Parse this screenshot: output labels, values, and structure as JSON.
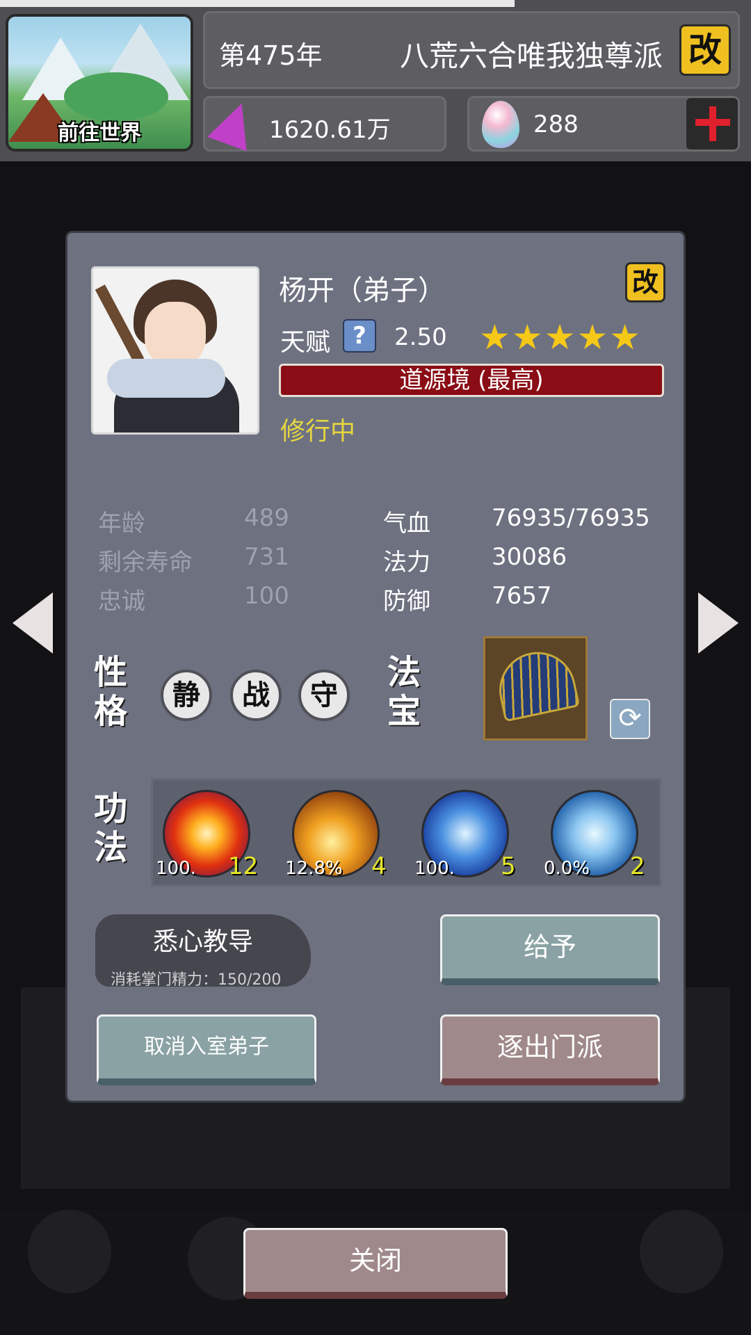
{
  "header": {
    "world_button": "前往世界",
    "year": "第475年",
    "sect_name": "八荒六合唯我独尊派",
    "rename_icon": "改",
    "spirit_stones": "1620.61万",
    "eggs": "288"
  },
  "disciple": {
    "name": "杨开（弟子）",
    "rename_icon": "改",
    "talent_label": "天赋",
    "talent_help": "?",
    "talent_value": "2.50",
    "stars": "★★★★★",
    "star_rating": 5,
    "realm": "道源境 (最高)",
    "status": "修行中"
  },
  "stats_left": [
    {
      "label": "年龄",
      "value": "489"
    },
    {
      "label": "剩余寿命",
      "value": "731"
    },
    {
      "label": "忠诚",
      "value": "100"
    }
  ],
  "stats_right": [
    {
      "label": "气血",
      "value": "76935/76935"
    },
    {
      "label": "法力",
      "value": "30086"
    },
    {
      "label": "防御",
      "value": "7657"
    }
  ],
  "personality": {
    "label_line1": "性",
    "label_line2": "格",
    "traits": [
      "静",
      "战",
      "守"
    ]
  },
  "treasure": {
    "label_line1": "法",
    "label_line2": "宝",
    "icon": "fan-icon"
  },
  "skills": {
    "label_line1": "功",
    "label_line2": "法",
    "items": [
      {
        "percent": "100.",
        "level": "12",
        "icon": "fire-burst-icon"
      },
      {
        "percent": "12.8%",
        "level": "4",
        "icon": "golden-fist-icon"
      },
      {
        "percent": "100.",
        "level": "5",
        "icon": "ice-swords-icon"
      },
      {
        "percent": "0.0%",
        "level": "2",
        "icon": "lightning-swords-icon"
      }
    ]
  },
  "actions": {
    "teach_label": "悉心教导",
    "teach_cost": "消耗掌门精力：150/200",
    "give_label": "给予",
    "cancel_label": "取消入室弟子",
    "expel_label": "逐出门派",
    "close_label": "关闭"
  },
  "colors": {
    "panel": "#6d7180",
    "realm_bar": "#8a0c14",
    "status": "#e6d640",
    "star": "#f6c818",
    "level": "#e6e62a"
  }
}
